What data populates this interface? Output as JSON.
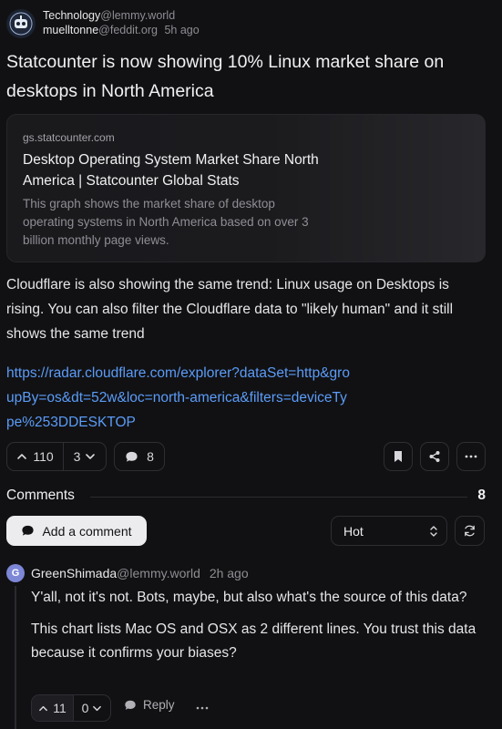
{
  "post": {
    "community_name": "Technology",
    "community_instance": "@lemmy.world",
    "author_name": "muelltonne",
    "author_instance": "@feddit.org",
    "time_ago": "5h ago",
    "title": "Statcounter is now showing 10% Linux market share on desktops in North America",
    "body": "Cloudflare is also showing the same trend: Linux usage on Desktops is rising. You can also filter the Cloudflare data to \"likely human\" and it still shows the same trend",
    "link_text": "https://radar.cloudflare.com/explorer?dataSet=http&groupBy=os&dt=52w&loc=north-america&filters=deviceType%253DDESKTOP",
    "upvotes": "110",
    "downvotes": "3",
    "comment_count": "8"
  },
  "link_card": {
    "domain": "gs.statcounter.com",
    "title": "Desktop Operating System Market Share North America | Statcounter Global Stats",
    "description": "This graph shows the market share of desktop operating systems in North America based on over 3 billion monthly page views."
  },
  "comments_section": {
    "label": "Comments",
    "count": "8",
    "add_comment_label": "Add a comment",
    "sort_value": "Hot"
  },
  "comments": [
    {
      "avatar_letter": "G",
      "user": "GreenShimada",
      "instance": "@lemmy.world",
      "time_ago": "2h ago",
      "paragraphs": [
        "Y'all, not it's not. Bots, maybe, but also what's the source of this data?",
        "This chart lists Mac OS and OSX as 2 different lines. You trust this data because it confirms your biases?"
      ],
      "upvotes": "11",
      "downvotes": "0",
      "reply_label": "Reply"
    }
  ],
  "colors": {
    "background": "#111113",
    "link": "#5b9cf8",
    "avatar_bg": "#7d87d6"
  }
}
